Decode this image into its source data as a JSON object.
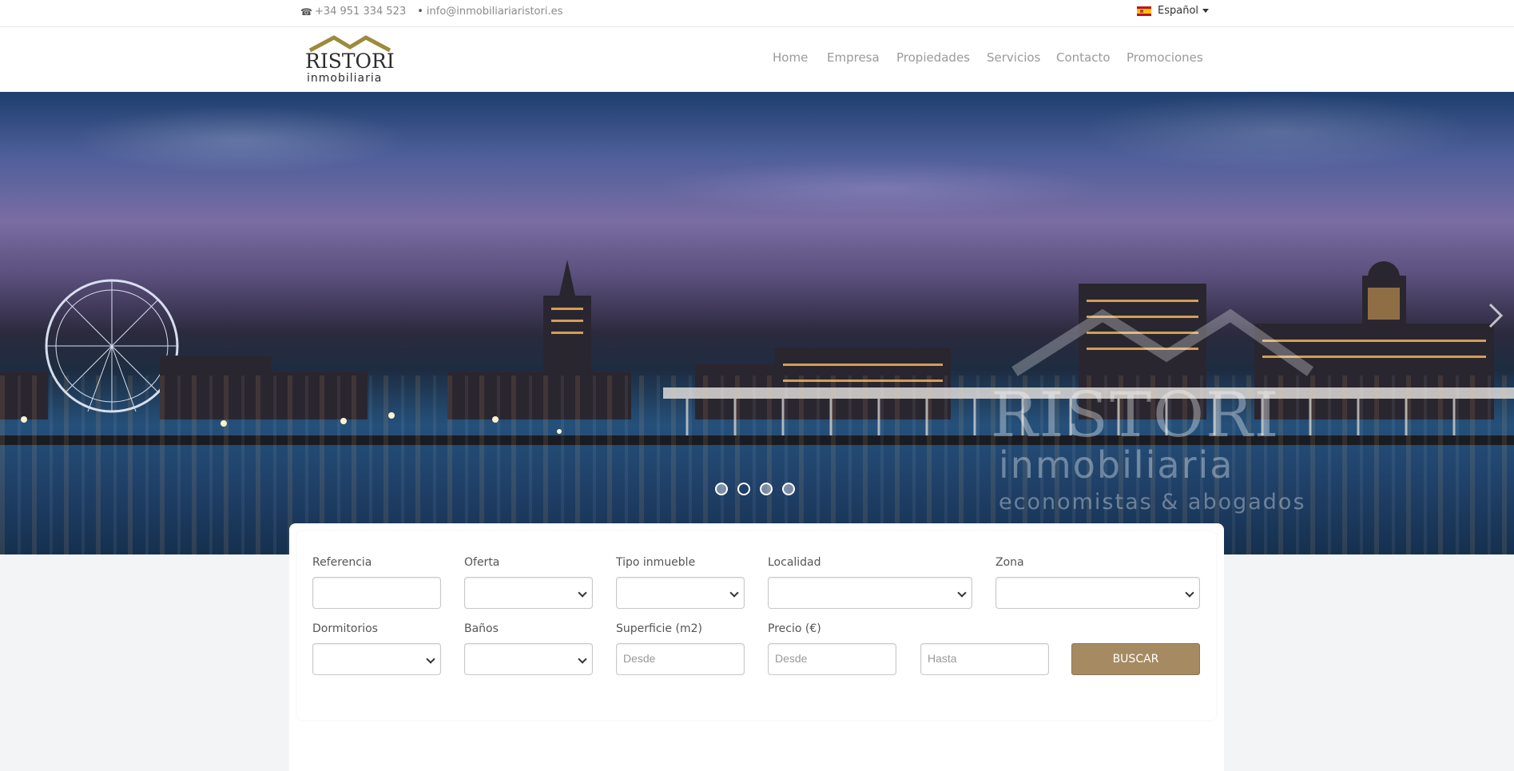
{
  "topbar": {
    "phone_icon": "phone-icon",
    "phone": "+34 951 334 523",
    "email": "info@inmobiliariaristori.es",
    "language": "Español",
    "language_flag": "spain-flag-icon"
  },
  "logo": {
    "name": "RISTORI",
    "subtitle": "inmobiliaria"
  },
  "nav": {
    "items": [
      "Home",
      "Empresa",
      "Propiedades",
      "Servicios",
      "Contacto",
      "Promociones"
    ]
  },
  "hero": {
    "watermark_name": "RISTORI",
    "watermark_sub": "inmobiliaria",
    "watermark_tag": "economistas & abogados",
    "slides": 4,
    "active_slide": 2
  },
  "search": {
    "labels": {
      "referencia": "Referencia",
      "oferta": "Oferta",
      "tipo": "Tipo inmueble",
      "localidad": "Localidad",
      "zona": "Zona",
      "dormitorios": "Dormitorios",
      "banos": "Baños",
      "superficie": "Superficie (m2)",
      "precio": "Precio (€)"
    },
    "placeholders": {
      "superficie_desde": "Desde",
      "precio_desde": "Desde",
      "precio_hasta": "Hasta"
    },
    "button": "BUSCAR"
  },
  "colors": {
    "accent": "#a58a62",
    "nav_text": "#9a9a9a"
  }
}
